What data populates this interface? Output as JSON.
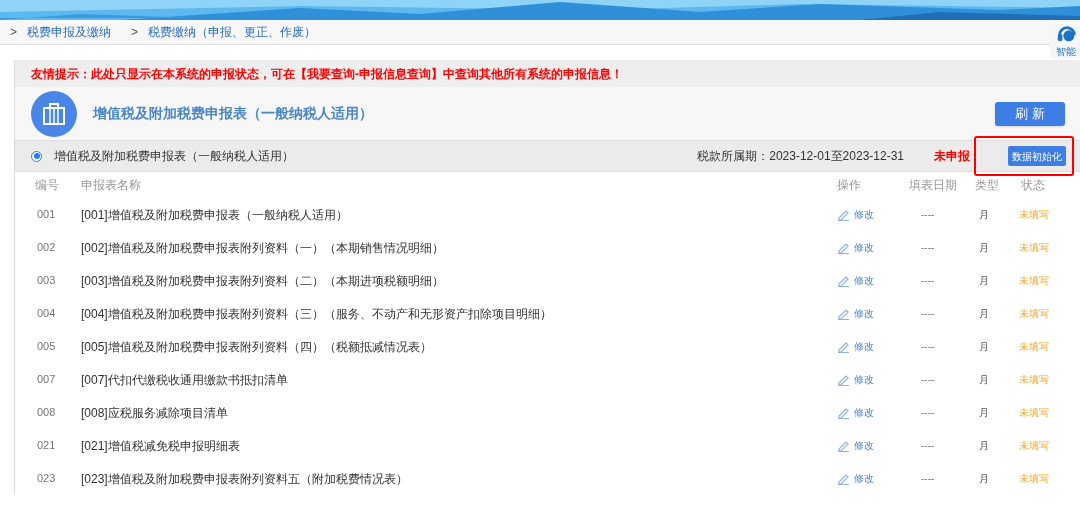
{
  "breadcrumb": [
    {
      "sep": ">",
      "label": "税费申报及缴纳"
    },
    {
      "sep": ">",
      "label": "税费缴纳（申报、更正、作废）"
    }
  ],
  "assistant": {
    "label": "智能"
  },
  "notice": "友情提示：此处只显示在本系统的申报状态，可在【我要查询-申报信息查询】中查询其他所有系统的申报信息！",
  "header": {
    "title": "增值税及附加税费申报表（一般纳税人适用）",
    "refresh_button": "刷 新"
  },
  "declaration": {
    "name": "增值税及附加税费申报表（一般纳税人适用）",
    "selected": true,
    "period": "税款所属期：2023-12-01至2023-12-31",
    "status": "未申报",
    "init_button": "数据初始化",
    "highlighted": true
  },
  "table": {
    "columns": [
      "编号",
      "申报表名称",
      "操作",
      "填表日期",
      "类型",
      "状态"
    ],
    "rows": [
      {
        "code": "001",
        "name": "[001]增值税及附加税费申报表（一般纳税人适用）",
        "action": "修改",
        "date": "----",
        "type": "月",
        "status": "未填写"
      },
      {
        "code": "002",
        "name": "[002]增值税及附加税费申报表附列资料（一）（本期销售情况明细）",
        "action": "修改",
        "date": "----",
        "type": "月",
        "status": "未填写"
      },
      {
        "code": "003",
        "name": "[003]增值税及附加税费申报表附列资料（二）（本期进项税额明细）",
        "action": "修改",
        "date": "----",
        "type": "月",
        "status": "未填写"
      },
      {
        "code": "004",
        "name": "[004]增值税及附加税费申报表附列资料（三）（服务、不动产和无形资产扣除项目明细）",
        "action": "修改",
        "date": "----",
        "type": "月",
        "status": "未填写"
      },
      {
        "code": "005",
        "name": "[005]增值税及附加税费申报表附列资料（四）（税额抵减情况表）",
        "action": "修改",
        "date": "----",
        "type": "月",
        "status": "未填写"
      },
      {
        "code": "007",
        "name": "[007]代扣代缴税收通用缴款书抵扣清单",
        "action": "修改",
        "date": "----",
        "type": "月",
        "status": "未填写"
      },
      {
        "code": "008",
        "name": "[008]应税服务减除项目清单",
        "action": "修改",
        "date": "----",
        "type": "月",
        "status": "未填写"
      },
      {
        "code": "021",
        "name": "[021]增值税减免税申报明细表",
        "action": "修改",
        "date": "----",
        "type": "月",
        "status": "未填写"
      },
      {
        "code": "023",
        "name": "[023]增值税及附加税费申报表附列资料五（附加税费情况表）",
        "action": "修改",
        "date": "----",
        "type": "月",
        "status": "未填写"
      }
    ]
  }
}
